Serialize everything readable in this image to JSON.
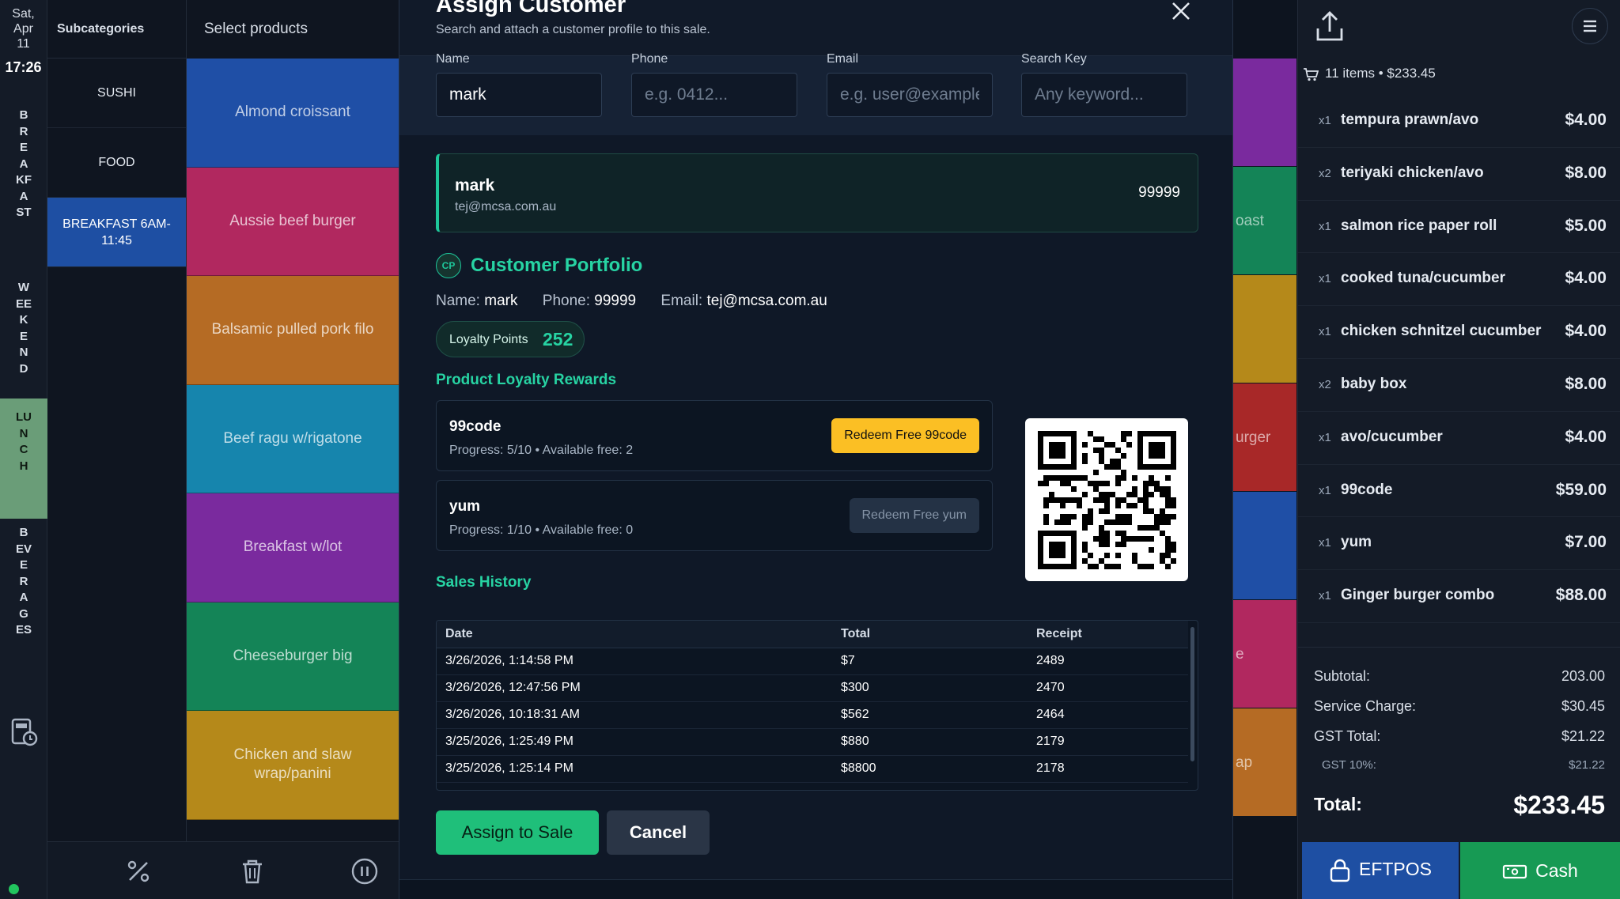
{
  "rail": {
    "date_lines": [
      "Sat,",
      "Apr",
      "11"
    ],
    "time": "17:26",
    "dayparts": [
      {
        "label": "BREAKFAST",
        "active": false
      },
      {
        "label": "WEEKEND",
        "active": false
      },
      {
        "label": "LUNCH",
        "active": true
      },
      {
        "label": "BEVERAGES",
        "active": false
      }
    ]
  },
  "subcategories": {
    "heading": "Subcategories",
    "items": [
      {
        "label": "SUSHI",
        "active": false
      },
      {
        "label": "FOOD",
        "active": false
      },
      {
        "label": "BREAKFAST 6AM-11:45",
        "active": true
      }
    ]
  },
  "products": {
    "heading": "Select products",
    "items": [
      {
        "label": "Almond croissant",
        "color": "#1f4fa6"
      },
      {
        "label": "Aussie beef burger",
        "color": "#b1285f"
      },
      {
        "label": "Balsamic pulled pork filo",
        "color": "#b56b24"
      },
      {
        "label": "Beef ragu w/rigatone",
        "color": "#1685ad"
      },
      {
        "label": "Breakfast w/lot",
        "color": "#7a2a9e"
      },
      {
        "label": "Cheeseburger big",
        "color": "#148457"
      },
      {
        "label": "Chicken and slaw wrap/panini",
        "color": "#b5891a"
      }
    ]
  },
  "background_tiles": [
    {
      "label": "oast",
      "color": "#148457"
    },
    {
      "label": "urger",
      "color": "#a82828"
    },
    {
      "label": "e",
      "color": "#b1285f"
    },
    {
      "label": "ap",
      "color": "#b56b24"
    }
  ],
  "modal": {
    "title": "Assign Customer",
    "subtitle": "Search and attach a customer profile to this sale.",
    "fields": [
      {
        "label": "Name",
        "value": "mark",
        "placeholder": ""
      },
      {
        "label": "Phone",
        "value": "",
        "placeholder": "e.g. 0412..."
      },
      {
        "label": "Email",
        "value": "",
        "placeholder": "e.g. user@example.com"
      },
      {
        "label": "Search Key",
        "value": "",
        "placeholder": "Any keyword..."
      }
    ],
    "result": {
      "name": "mark",
      "email": "tej@mcsa.com.au",
      "phone": "99999"
    },
    "portfolio": {
      "badge": "CP",
      "title": "Customer Portfolio",
      "name_label": "Name:",
      "name": "mark",
      "phone_label": "Phone:",
      "phone": "99999",
      "email_label": "Email:",
      "email": "tej@mcsa.com.au",
      "loyalty_label": "Loyalty Points",
      "loyalty_points": "252"
    },
    "rewards_title": "Product Loyalty Rewards",
    "rewards": [
      {
        "name": "99code",
        "progress": "Progress: 5/10 • Available free: 2",
        "button": "Redeem Free 99code",
        "enabled": true
      },
      {
        "name": "yum",
        "progress": "Progress: 1/10 • Available free: 0",
        "button": "Redeem Free yum",
        "enabled": false
      }
    ],
    "history_title": "Sales History",
    "history_columns": [
      "Date",
      "Total",
      "Receipt"
    ],
    "history_rows": [
      [
        "3/26/2026, 1:14:58 PM",
        "$7",
        "2489"
      ],
      [
        "3/26/2026, 12:47:56 PM",
        "$300",
        "2470"
      ],
      [
        "3/26/2026, 10:18:31 AM",
        "$562",
        "2464"
      ],
      [
        "3/25/2026, 1:25:49 PM",
        "$880",
        "2179"
      ],
      [
        "3/25/2026, 1:25:14 PM",
        "$8800",
        "2178"
      ]
    ],
    "assign_label": "Assign to Sale",
    "cancel_label": "Cancel"
  },
  "order": {
    "summary": "11 items • $233.45",
    "lines": [
      {
        "qty": "x1",
        "name": "tempura prawn/avo",
        "price": "$4.00"
      },
      {
        "qty": "x2",
        "name": "teriyaki chicken/avo",
        "price": "$8.00"
      },
      {
        "qty": "x1",
        "name": "salmon rice paper roll",
        "price": "$5.00"
      },
      {
        "qty": "x1",
        "name": "cooked tuna/cucumber",
        "price": "$4.00"
      },
      {
        "qty": "x1",
        "name": "chicken schnitzel cucumber",
        "price": "$4.00"
      },
      {
        "qty": "x2",
        "name": "baby box",
        "price": "$8.00"
      },
      {
        "qty": "x1",
        "name": "avo/cucumber",
        "price": "$4.00"
      },
      {
        "qty": "x1",
        "name": "99code",
        "price": "$59.00"
      },
      {
        "qty": "x1",
        "name": "yum",
        "price": "$7.00"
      },
      {
        "qty": "x1",
        "name": "Ginger burger combo",
        "price": "$88.00"
      }
    ],
    "subtotal_label": "Subtotal:",
    "subtotal": "203.00",
    "service_label": "Service Charge:",
    "service": "$30.45",
    "gst_label": "GST Total:",
    "gst": "$21.22",
    "gst10_label": "GST 10%:",
    "gst10": "$21.22",
    "total_label": "Total:",
    "total": "$233.45",
    "eftpos_label": "EFTPOS",
    "cash_label": "Cash"
  },
  "colors": {
    "accent": "#27d3a3",
    "eftpos": "#1e4fa3",
    "cash": "#179a54",
    "redeem": "#fbbf24"
  },
  "icons": [
    "calculator-icon",
    "percent-icon",
    "trash-icon",
    "pause-icon",
    "close-icon",
    "share-icon",
    "menu-icon",
    "cart-icon",
    "lock-icon",
    "cash-icon",
    "qr-code"
  ]
}
